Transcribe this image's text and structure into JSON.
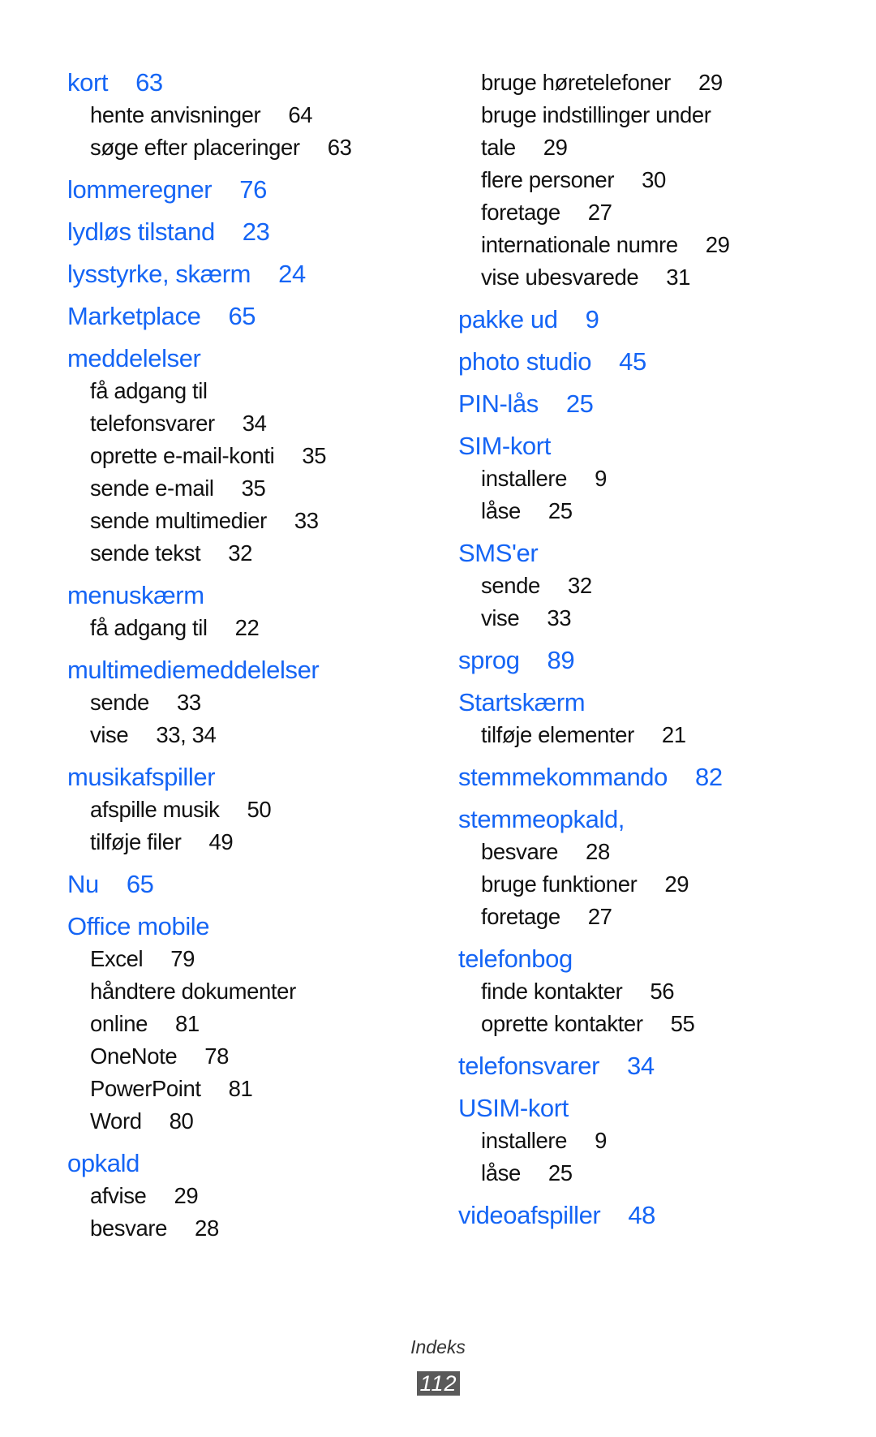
{
  "document": {
    "section_title": "Indeks",
    "page_number": "112",
    "colors": {
      "heading": "#1565f5",
      "text": "#111111",
      "page_badge": "#5a5a5a"
    }
  },
  "columns": [
    {
      "entries": [
        {
          "type": "heading",
          "lines": [
            "kort"
          ],
          "pages": "63"
        },
        {
          "type": "sub",
          "lines": [
            "hente anvisninger"
          ],
          "pages": "64"
        },
        {
          "type": "sub",
          "lines": [
            "søge efter placeringer"
          ],
          "pages": "63"
        },
        {
          "type": "heading",
          "lines": [
            "lommeregner"
          ],
          "pages": "76"
        },
        {
          "type": "heading",
          "lines": [
            "lydløs tilstand"
          ],
          "pages": "23"
        },
        {
          "type": "heading",
          "lines": [
            "lysstyrke, skærm"
          ],
          "pages": "24"
        },
        {
          "type": "heading",
          "lines": [
            "Marketplace"
          ],
          "pages": "65"
        },
        {
          "type": "heading",
          "lines": [
            "meddelelser"
          ],
          "pages": ""
        },
        {
          "type": "sub",
          "lines": [
            "få adgang til",
            "telefonsvarer"
          ],
          "pages": "34"
        },
        {
          "type": "sub",
          "lines": [
            "oprette e-mail-konti"
          ],
          "pages": "35"
        },
        {
          "type": "sub",
          "lines": [
            "sende e-mail"
          ],
          "pages": "35"
        },
        {
          "type": "sub",
          "lines": [
            "sende multimedier"
          ],
          "pages": "33"
        },
        {
          "type": "sub",
          "lines": [
            "sende tekst"
          ],
          "pages": "32"
        },
        {
          "type": "heading",
          "lines": [
            "menuskærm"
          ],
          "pages": ""
        },
        {
          "type": "sub",
          "lines": [
            "få adgang til"
          ],
          "pages": "22"
        },
        {
          "type": "heading",
          "lines": [
            "multimediemeddelelser"
          ],
          "pages": ""
        },
        {
          "type": "sub",
          "lines": [
            "sende"
          ],
          "pages": "33"
        },
        {
          "type": "sub",
          "lines": [
            "vise"
          ],
          "pages": "33, 34"
        },
        {
          "type": "heading",
          "lines": [
            "musikafspiller"
          ],
          "pages": ""
        },
        {
          "type": "sub",
          "lines": [
            "afspille musik"
          ],
          "pages": "50"
        },
        {
          "type": "sub",
          "lines": [
            "tilføje filer"
          ],
          "pages": "49"
        },
        {
          "type": "heading",
          "lines": [
            "Nu"
          ],
          "pages": "65"
        },
        {
          "type": "heading",
          "lines": [
            "Office mobile"
          ],
          "pages": ""
        },
        {
          "type": "sub",
          "lines": [
            "Excel"
          ],
          "pages": "79"
        },
        {
          "type": "sub",
          "lines": [
            "håndtere dokumenter",
            "online"
          ],
          "pages": "81"
        },
        {
          "type": "sub",
          "lines": [
            "OneNote"
          ],
          "pages": "78"
        },
        {
          "type": "sub",
          "lines": [
            "PowerPoint"
          ],
          "pages": "81"
        },
        {
          "type": "sub",
          "lines": [
            "Word"
          ],
          "pages": "80"
        },
        {
          "type": "heading",
          "lines": [
            "opkald"
          ],
          "pages": ""
        },
        {
          "type": "sub",
          "lines": [
            "afvise"
          ],
          "pages": "29"
        },
        {
          "type": "sub",
          "lines": [
            "besvare"
          ],
          "pages": "28"
        }
      ]
    },
    {
      "entries": [
        {
          "type": "sub",
          "lines": [
            "bruge høretelefoner"
          ],
          "pages": "29"
        },
        {
          "type": "sub",
          "lines": [
            "bruge indstillinger under",
            "tale"
          ],
          "pages": "29"
        },
        {
          "type": "sub",
          "lines": [
            "flere personer"
          ],
          "pages": "30"
        },
        {
          "type": "sub",
          "lines": [
            "foretage"
          ],
          "pages": "27"
        },
        {
          "type": "sub",
          "lines": [
            "internationale numre"
          ],
          "pages": "29"
        },
        {
          "type": "sub",
          "lines": [
            "vise ubesvarede"
          ],
          "pages": "31"
        },
        {
          "type": "heading",
          "lines": [
            "pakke ud"
          ],
          "pages": "9"
        },
        {
          "type": "heading",
          "lines": [
            "photo studio"
          ],
          "pages": "45"
        },
        {
          "type": "heading",
          "lines": [
            "PIN-lås"
          ],
          "pages": "25"
        },
        {
          "type": "heading",
          "lines": [
            "SIM-kort"
          ],
          "pages": ""
        },
        {
          "type": "sub",
          "lines": [
            "installere"
          ],
          "pages": "9"
        },
        {
          "type": "sub",
          "lines": [
            "låse"
          ],
          "pages": "25"
        },
        {
          "type": "heading",
          "lines": [
            "SMS'er"
          ],
          "pages": ""
        },
        {
          "type": "sub",
          "lines": [
            "sende"
          ],
          "pages": "32"
        },
        {
          "type": "sub",
          "lines": [
            "vise"
          ],
          "pages": "33"
        },
        {
          "type": "heading",
          "lines": [
            "sprog"
          ],
          "pages": "89"
        },
        {
          "type": "heading",
          "lines": [
            "Startskærm"
          ],
          "pages": ""
        },
        {
          "type": "sub",
          "lines": [
            "tilføje elementer"
          ],
          "pages": "21"
        },
        {
          "type": "heading",
          "lines": [
            "stemmekommando"
          ],
          "pages": "82"
        },
        {
          "type": "heading",
          "lines": [
            "stemmeopkald,"
          ],
          "pages": ""
        },
        {
          "type": "sub",
          "lines": [
            "besvare"
          ],
          "pages": "28"
        },
        {
          "type": "sub",
          "lines": [
            "bruge funktioner"
          ],
          "pages": "29"
        },
        {
          "type": "sub",
          "lines": [
            "foretage"
          ],
          "pages": "27"
        },
        {
          "type": "heading",
          "lines": [
            "telefonbog"
          ],
          "pages": ""
        },
        {
          "type": "sub",
          "lines": [
            "finde kontakter"
          ],
          "pages": "56"
        },
        {
          "type": "sub",
          "lines": [
            "oprette kontakter"
          ],
          "pages": "55"
        },
        {
          "type": "heading",
          "lines": [
            "telefonsvarer"
          ],
          "pages": "34"
        },
        {
          "type": "heading",
          "lines": [
            "USIM-kort"
          ],
          "pages": ""
        },
        {
          "type": "sub",
          "lines": [
            "installere"
          ],
          "pages": "9"
        },
        {
          "type": "sub",
          "lines": [
            "låse"
          ],
          "pages": "25"
        },
        {
          "type": "heading",
          "lines": [
            "videoafspiller"
          ],
          "pages": "48"
        }
      ]
    }
  ]
}
